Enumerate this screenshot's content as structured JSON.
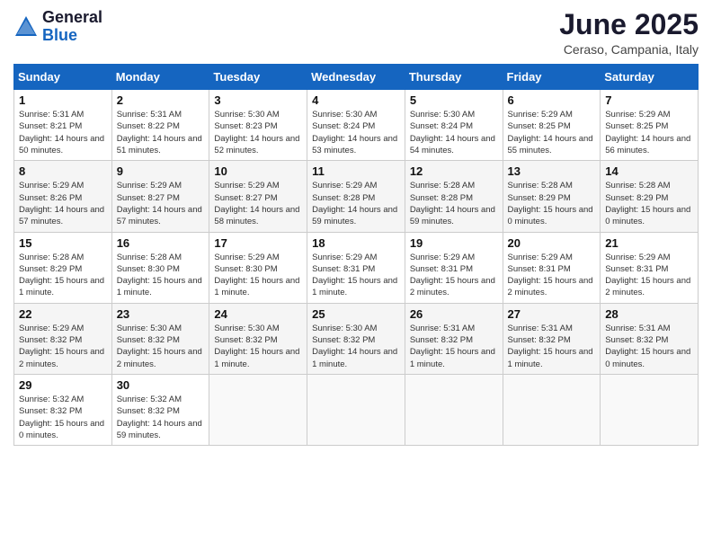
{
  "header": {
    "logo_general": "General",
    "logo_blue": "Blue",
    "month_title": "June 2025",
    "location": "Ceraso, Campania, Italy"
  },
  "weekdays": [
    "Sunday",
    "Monday",
    "Tuesday",
    "Wednesday",
    "Thursday",
    "Friday",
    "Saturday"
  ],
  "weeks": [
    [
      {
        "day": "1",
        "sunrise": "5:31 AM",
        "sunset": "8:21 PM",
        "daylight": "14 hours and 50 minutes."
      },
      {
        "day": "2",
        "sunrise": "5:31 AM",
        "sunset": "8:22 PM",
        "daylight": "14 hours and 51 minutes."
      },
      {
        "day": "3",
        "sunrise": "5:30 AM",
        "sunset": "8:23 PM",
        "daylight": "14 hours and 52 minutes."
      },
      {
        "day": "4",
        "sunrise": "5:30 AM",
        "sunset": "8:24 PM",
        "daylight": "14 hours and 53 minutes."
      },
      {
        "day": "5",
        "sunrise": "5:30 AM",
        "sunset": "8:24 PM",
        "daylight": "14 hours and 54 minutes."
      },
      {
        "day": "6",
        "sunrise": "5:29 AM",
        "sunset": "8:25 PM",
        "daylight": "14 hours and 55 minutes."
      },
      {
        "day": "7",
        "sunrise": "5:29 AM",
        "sunset": "8:25 PM",
        "daylight": "14 hours and 56 minutes."
      }
    ],
    [
      {
        "day": "8",
        "sunrise": "5:29 AM",
        "sunset": "8:26 PM",
        "daylight": "14 hours and 57 minutes."
      },
      {
        "day": "9",
        "sunrise": "5:29 AM",
        "sunset": "8:27 PM",
        "daylight": "14 hours and 57 minutes."
      },
      {
        "day": "10",
        "sunrise": "5:29 AM",
        "sunset": "8:27 PM",
        "daylight": "14 hours and 58 minutes."
      },
      {
        "day": "11",
        "sunrise": "5:29 AM",
        "sunset": "8:28 PM",
        "daylight": "14 hours and 59 minutes."
      },
      {
        "day": "12",
        "sunrise": "5:28 AM",
        "sunset": "8:28 PM",
        "daylight": "14 hours and 59 minutes."
      },
      {
        "day": "13",
        "sunrise": "5:28 AM",
        "sunset": "8:29 PM",
        "daylight": "15 hours and 0 minutes."
      },
      {
        "day": "14",
        "sunrise": "5:28 AM",
        "sunset": "8:29 PM",
        "daylight": "15 hours and 0 minutes."
      }
    ],
    [
      {
        "day": "15",
        "sunrise": "5:28 AM",
        "sunset": "8:29 PM",
        "daylight": "15 hours and 1 minute."
      },
      {
        "day": "16",
        "sunrise": "5:28 AM",
        "sunset": "8:30 PM",
        "daylight": "15 hours and 1 minute."
      },
      {
        "day": "17",
        "sunrise": "5:29 AM",
        "sunset": "8:30 PM",
        "daylight": "15 hours and 1 minute."
      },
      {
        "day": "18",
        "sunrise": "5:29 AM",
        "sunset": "8:31 PM",
        "daylight": "15 hours and 1 minute."
      },
      {
        "day": "19",
        "sunrise": "5:29 AM",
        "sunset": "8:31 PM",
        "daylight": "15 hours and 2 minutes."
      },
      {
        "day": "20",
        "sunrise": "5:29 AM",
        "sunset": "8:31 PM",
        "daylight": "15 hours and 2 minutes."
      },
      {
        "day": "21",
        "sunrise": "5:29 AM",
        "sunset": "8:31 PM",
        "daylight": "15 hours and 2 minutes."
      }
    ],
    [
      {
        "day": "22",
        "sunrise": "5:29 AM",
        "sunset": "8:32 PM",
        "daylight": "15 hours and 2 minutes."
      },
      {
        "day": "23",
        "sunrise": "5:30 AM",
        "sunset": "8:32 PM",
        "daylight": "15 hours and 2 minutes."
      },
      {
        "day": "24",
        "sunrise": "5:30 AM",
        "sunset": "8:32 PM",
        "daylight": "15 hours and 1 minute."
      },
      {
        "day": "25",
        "sunrise": "5:30 AM",
        "sunset": "8:32 PM",
        "daylight": "14 hours and 1 minute."
      },
      {
        "day": "26",
        "sunrise": "5:31 AM",
        "sunset": "8:32 PM",
        "daylight": "15 hours and 1 minute."
      },
      {
        "day": "27",
        "sunrise": "5:31 AM",
        "sunset": "8:32 PM",
        "daylight": "15 hours and 1 minute."
      },
      {
        "day": "28",
        "sunrise": "5:31 AM",
        "sunset": "8:32 PM",
        "daylight": "15 hours and 0 minutes."
      }
    ],
    [
      {
        "day": "29",
        "sunrise": "5:32 AM",
        "sunset": "8:32 PM",
        "daylight": "15 hours and 0 minutes."
      },
      {
        "day": "30",
        "sunrise": "5:32 AM",
        "sunset": "8:32 PM",
        "daylight": "14 hours and 59 minutes."
      },
      null,
      null,
      null,
      null,
      null
    ]
  ]
}
